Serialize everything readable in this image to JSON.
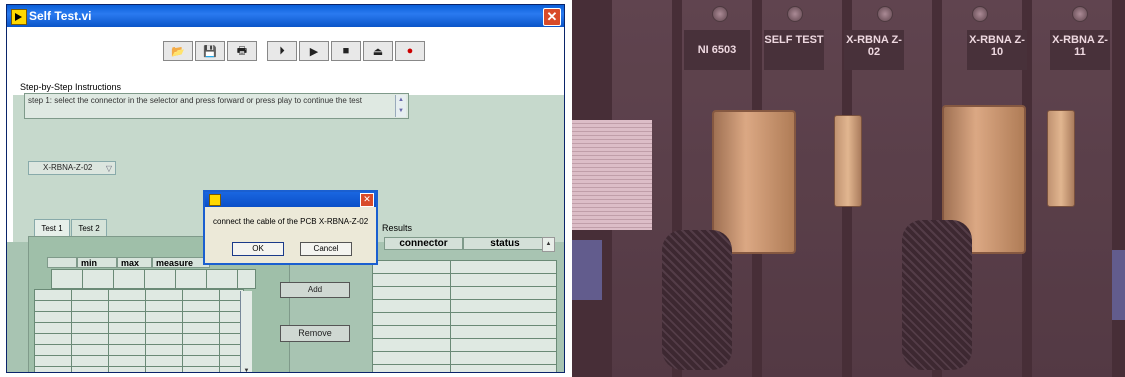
{
  "window": {
    "title": "Self Test.vi",
    "close_glyph": "✕"
  },
  "toolbar": {
    "buttons": [
      {
        "name": "open-folder-icon",
        "glyph": "📂"
      },
      {
        "name": "save-icon",
        "glyph": "💾"
      },
      {
        "name": "print-icon",
        "glyph": "🖶"
      },
      {
        "name": "step-forward-icon",
        "glyph": "⏵"
      },
      {
        "name": "play-icon",
        "glyph": "▶"
      },
      {
        "name": "stop-icon",
        "glyph": "■"
      },
      {
        "name": "eject-icon",
        "glyph": "⏏"
      },
      {
        "name": "record-icon",
        "glyph": "●"
      }
    ]
  },
  "instructions": {
    "label": "Step-by-Step Instructions",
    "text": "step 1: select the connector in the selector and press forward or press play to continue the test"
  },
  "selector": {
    "value": "X-RBNA-Z-02"
  },
  "tabs": [
    "Test 1",
    "Test 2"
  ],
  "measure_table": {
    "headers": [
      "",
      "min",
      "max",
      "measure"
    ]
  },
  "buttons": {
    "add": "Add",
    "remove": "Remove"
  },
  "results": {
    "label": "Results",
    "headers": [
      "connector",
      "status"
    ]
  },
  "dialog": {
    "message": "connect the cable of the PCB X-RBNA-Z-02",
    "ok": "OK",
    "cancel": "Cancel"
  },
  "photo": {
    "module_labels": [
      "NI 6503",
      "SELF TEST",
      "X-RBNA Z-02",
      "X-RBNA Z-10",
      "X-RBNA Z-11"
    ]
  },
  "colors": {
    "titlebar": "#0a5fd8",
    "panel_green": "#c6d9cc",
    "dialog_border": "#1a5fd0",
    "record_red": "#cc0000"
  }
}
